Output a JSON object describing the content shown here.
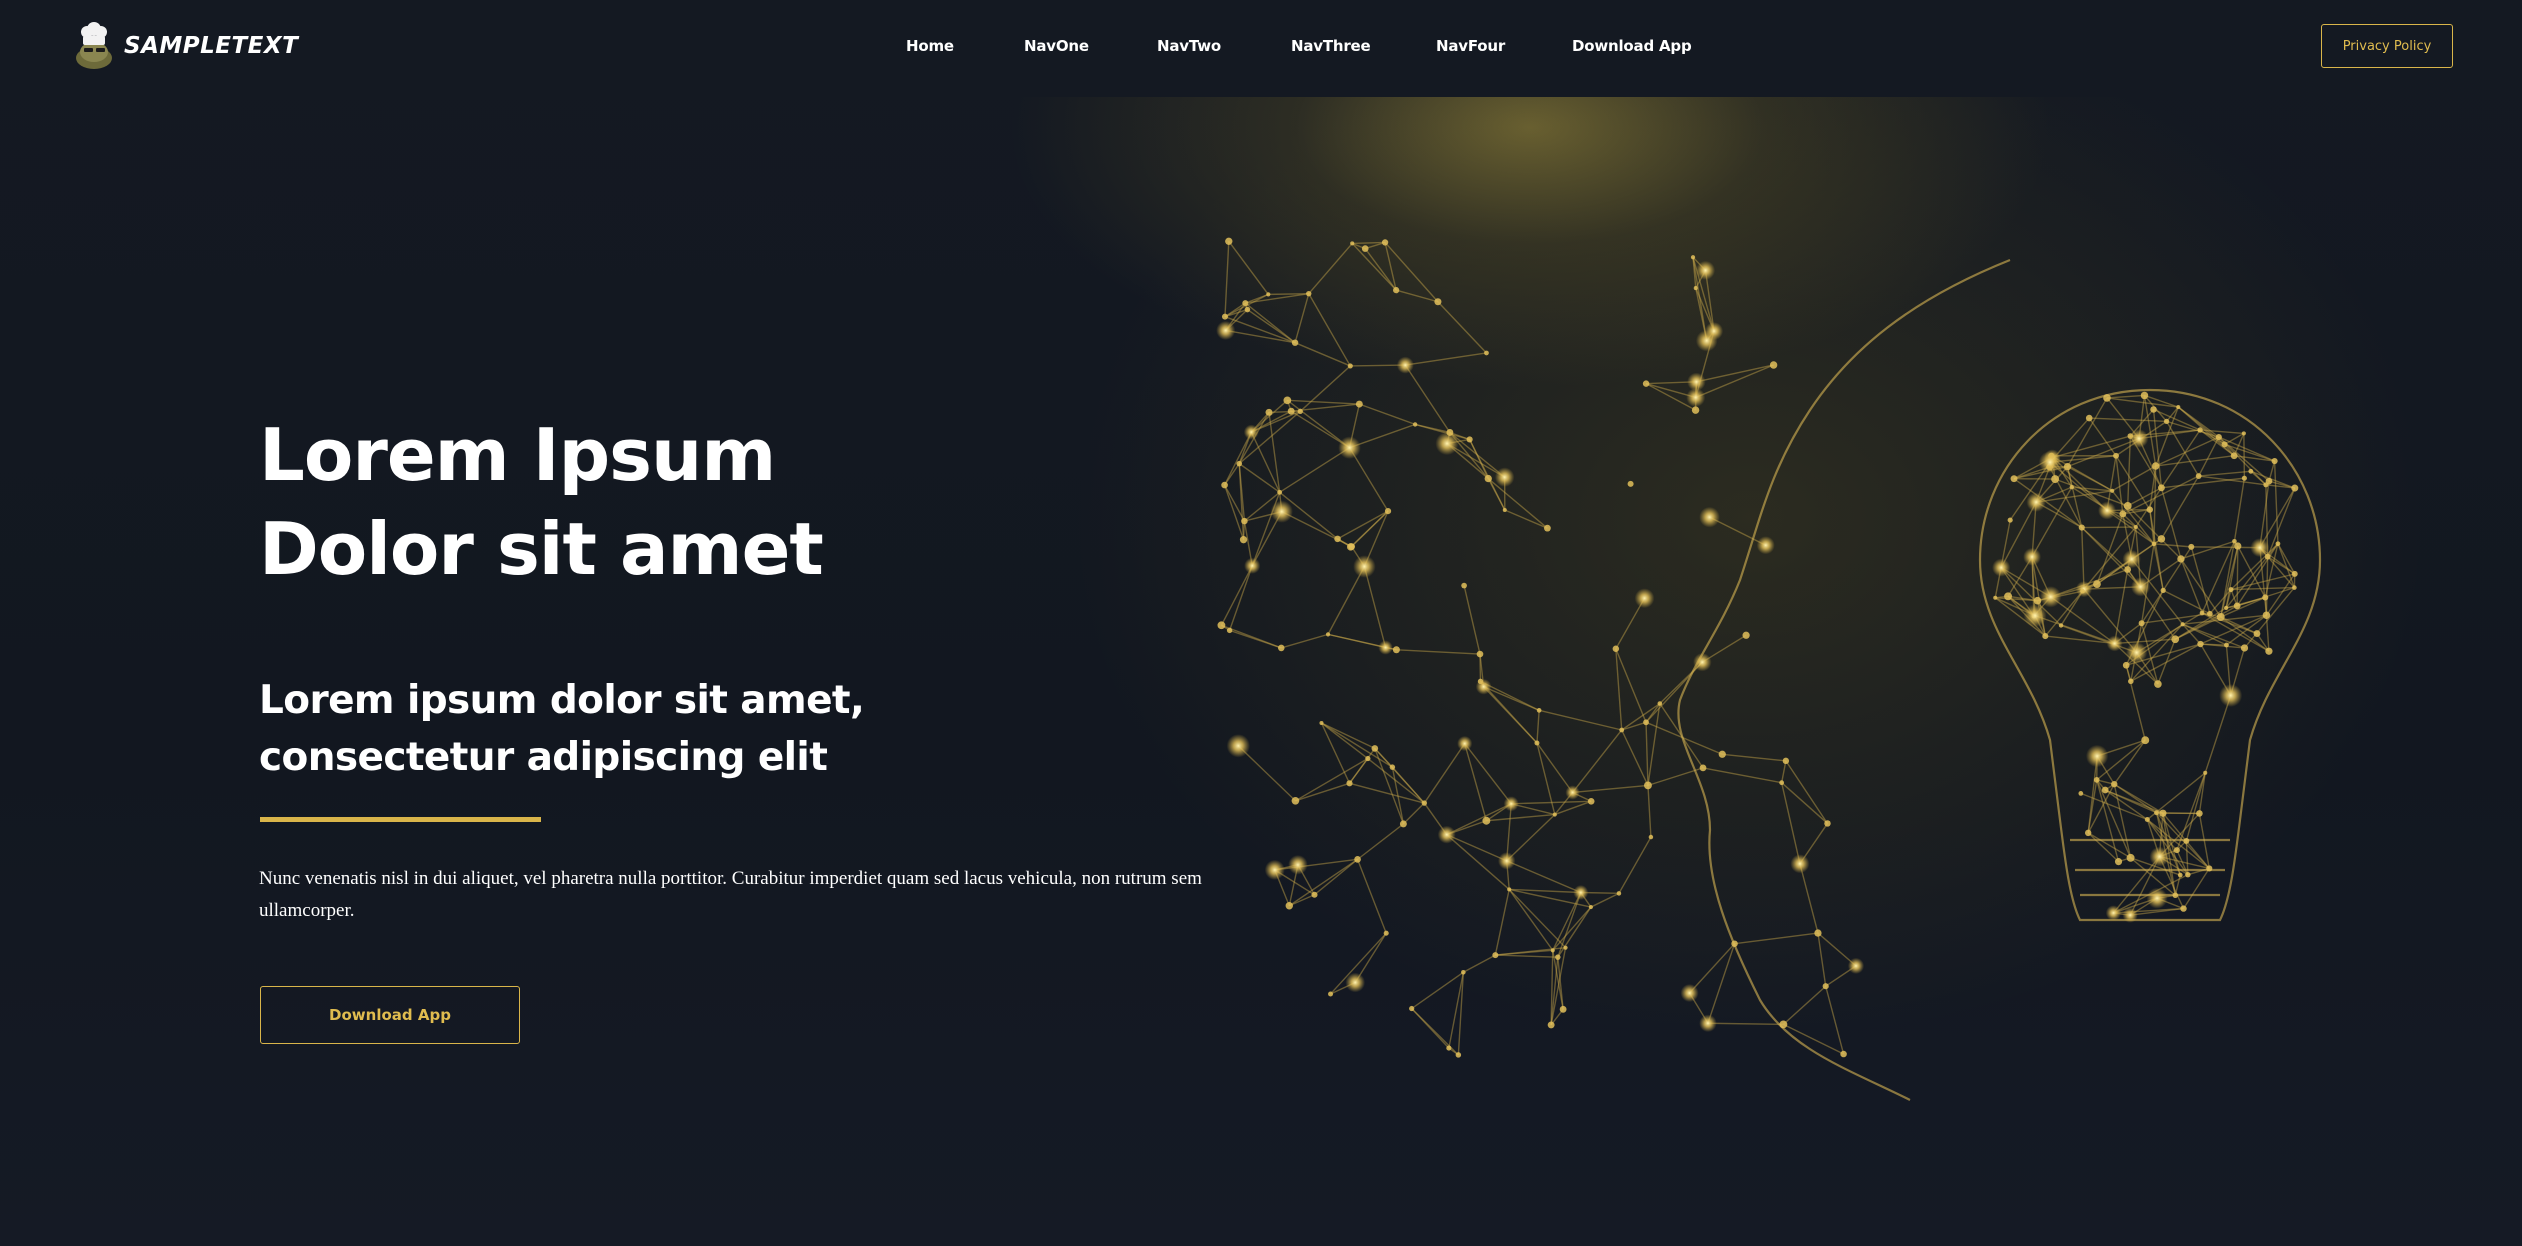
{
  "header": {
    "brand": "SAMPLETEXT",
    "logo_icon": "chef-mascot-icon",
    "nav_items": [
      "Home",
      "NavOne",
      "NavTwo",
      "NavThree",
      "NavFour",
      "Download App"
    ],
    "privacy_label": "Privacy Policy"
  },
  "hero": {
    "title_line1": "Lorem Ipsum",
    "title_line2": "Dolor sit amet",
    "subtitle_line1": "Lorem ipsum dolor sit amet,",
    "subtitle_line2": "consectetur adipiscing elit",
    "body": "Nunc venenatis nisl in dui aliquet, vel pharetra nulla porttitor. Curabitur imperdiet quam sed lacus vehicula, non rutrum sem ullamcorper.",
    "cta_label": "Download App",
    "illustration": "network-head-lightbulb-illustration"
  },
  "colors": {
    "background": "#131821",
    "accent": "#d9b54a",
    "text": "#ffffff"
  }
}
